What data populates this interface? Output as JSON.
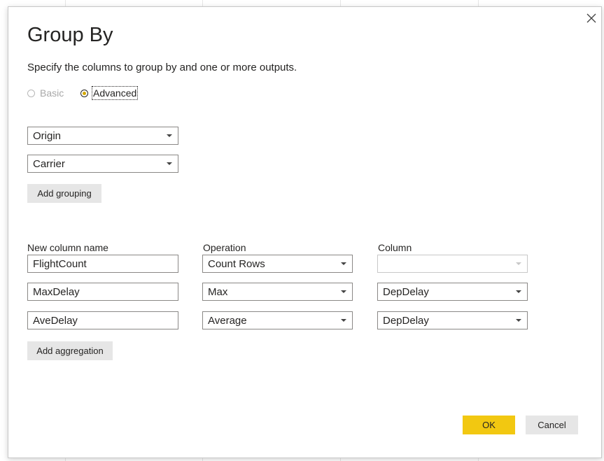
{
  "dialog": {
    "title": "Group By",
    "subtitle": "Specify the columns to group by and one or more outputs.",
    "close_icon": "close-icon"
  },
  "mode": {
    "basic_label": "Basic",
    "advanced_label": "Advanced",
    "selected": "Advanced"
  },
  "grouping": {
    "fields": [
      "Origin",
      "Carrier"
    ],
    "add_label": "Add grouping"
  },
  "aggregation": {
    "headers": {
      "name": "New column name",
      "operation": "Operation",
      "column": "Column"
    },
    "rows": [
      {
        "name": "FlightCount",
        "operation": "Count Rows",
        "column": "",
        "column_enabled": false
      },
      {
        "name": "MaxDelay",
        "operation": "Max",
        "column": "DepDelay",
        "column_enabled": true
      },
      {
        "name": "AveDelay",
        "operation": "Average",
        "column": "DepDelay",
        "column_enabled": true
      }
    ],
    "add_label": "Add aggregation"
  },
  "footer": {
    "ok_label": "OK",
    "cancel_label": "Cancel"
  },
  "colors": {
    "primary_button": "#f2c811",
    "secondary_button": "#e6e6e6",
    "radio_selected": "#d4a800"
  }
}
